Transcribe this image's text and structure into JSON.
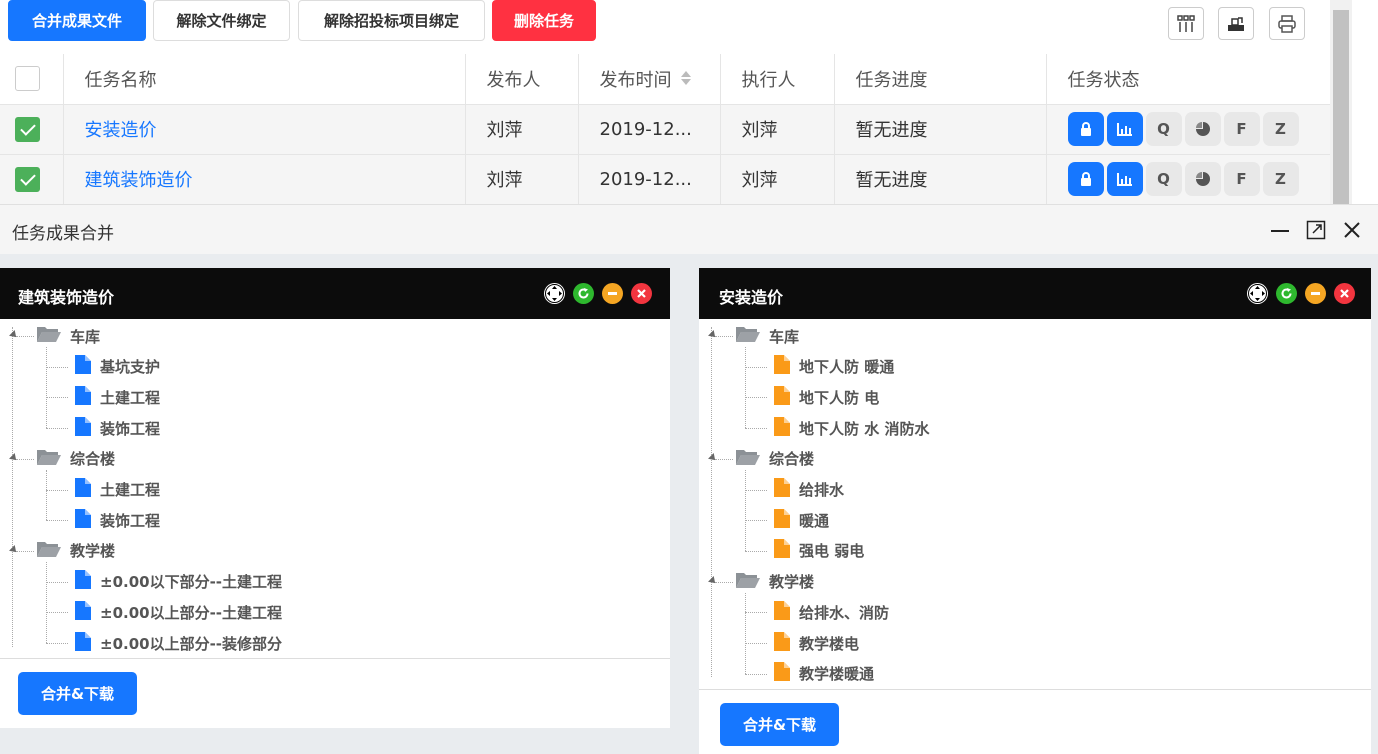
{
  "toolbar": {
    "merge_files": "合并成果文件",
    "unbind_files": "解除文件绑定",
    "unbind_bid": "解除招投标项目绑定",
    "delete_task": "删除任务"
  },
  "table": {
    "headers": [
      "任务名称",
      "发布人",
      "发布时间",
      "执行人",
      "任务进度",
      "任务状态"
    ],
    "rows": [
      {
        "name": "安装造价",
        "publisher": "刘萍",
        "time": "2019-12...",
        "executor": "刘萍",
        "progress": "暂无进度"
      },
      {
        "name": "建筑装饰造价",
        "publisher": "刘萍",
        "time": "2019-12...",
        "executor": "刘萍",
        "progress": "暂无进度"
      }
    ],
    "status_letters": [
      "Q",
      "F",
      "Z"
    ]
  },
  "dialog": {
    "title": "任务成果合并"
  },
  "panels": [
    {
      "title": "建筑装饰造价",
      "button": "合并&下载",
      "groups": [
        {
          "label": "车库",
          "items": [
            "基坑支护",
            "土建工程",
            "装饰工程"
          ]
        },
        {
          "label": "综合楼",
          "items": [
            "土建工程",
            "装饰工程"
          ]
        },
        {
          "label": "教学楼",
          "items": [
            "±0.00以下部分--土建工程",
            "±0.00以上部分--土建工程",
            "±0.00以上部分--装修部分"
          ]
        }
      ]
    },
    {
      "title": "安装造价",
      "button": "合并&下载",
      "groups": [
        {
          "label": "车库",
          "items": [
            "地下人防 暖通",
            "地下人防 电",
            "地下人防 水 消防水"
          ]
        },
        {
          "label": "综合楼",
          "items": [
            "给排水",
            "暖通",
            "强电 弱电"
          ]
        },
        {
          "label": "教学楼",
          "items": [
            "给排水、消防",
            "教学楼电",
            "教学楼暖通"
          ]
        }
      ]
    }
  ],
  "colors": {
    "primary": "#1677ff",
    "danger": "#ff3141",
    "check": "#4cb05a",
    "file_blue": "#1677ff",
    "file_orange": "#fa9a18",
    "folder": "#8c9196"
  }
}
